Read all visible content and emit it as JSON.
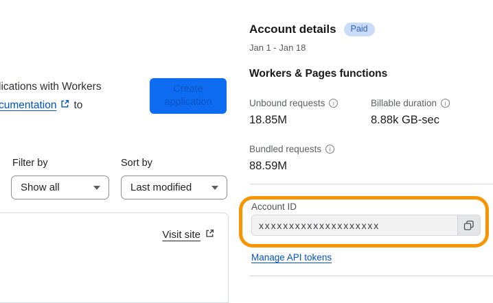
{
  "colors": {
    "accent_blue": "#0d6cf2",
    "link_blue": "#0051c3",
    "badge_bg": "#c9dcfa",
    "badge_text": "#2f5fc0",
    "highlight_orange": "#f79400"
  },
  "left_panel": {
    "intro_line1": "lications with Workers",
    "intro_link_text": "cumentation",
    "intro_after_link": "to",
    "create_button_label": "Create application",
    "filter_label": "Filter by",
    "filter_value": "Show all",
    "sort_label": "Sort by",
    "sort_value": "Last modified",
    "visit_site_label": "Visit site"
  },
  "account_details": {
    "title": "Account details",
    "plan_badge": "Paid",
    "date_range": "Jan 1 - Jan 18",
    "section_title": "Workers & Pages functions",
    "metrics": [
      {
        "label": "Unbound requests",
        "value": "18.85M"
      },
      {
        "label": "Billable duration",
        "value": "8.88k GB-sec"
      },
      {
        "label": "Bundled requests",
        "value": "88.59M"
      }
    ],
    "account_id_label": "Account ID",
    "account_id_value": "xxxxxxxxxxxxxxxxxxxx",
    "manage_tokens_label": "Manage API tokens"
  },
  "icons": {
    "info_glyph": "i"
  }
}
